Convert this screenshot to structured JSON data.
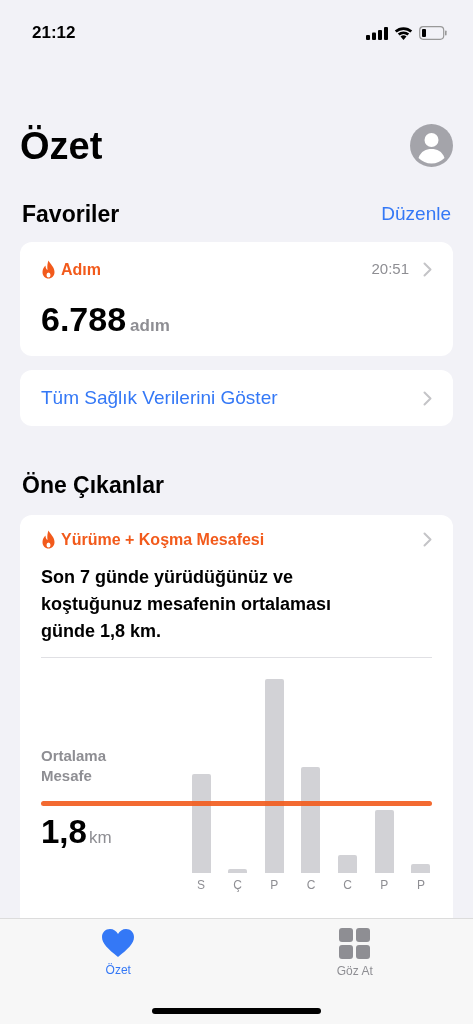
{
  "status_bar": {
    "time": "21:12"
  },
  "title": "Özet",
  "favorites": {
    "heading": "Favoriler",
    "edit": "Düzenle",
    "card": {
      "label": "Adım",
      "time": "20:51",
      "value": "6.788",
      "unit": "adım"
    },
    "show_all": "Tüm Sağlık Verilerini Göster"
  },
  "highlights": {
    "heading": "Öne Çıkanlar",
    "card": {
      "label": "Yürüme + Koşma Mesafesi",
      "text": "Son 7 günde yürüdüğünüz ve koştuğunuz mesafenin ortalaması günde 1,8 km.",
      "average_label": "Ortalama Mesafe",
      "average_value": "1,8",
      "average_unit": "km",
      "day_labels": [
        "S",
        "Ç",
        "P",
        "C",
        "C",
        "P",
        "P"
      ]
    }
  },
  "tab_bar": [
    {
      "label": "Özet",
      "kind": "heart",
      "selected": true
    },
    {
      "label": "Göz At",
      "kind": "grid",
      "selected": false
    }
  ]
}
